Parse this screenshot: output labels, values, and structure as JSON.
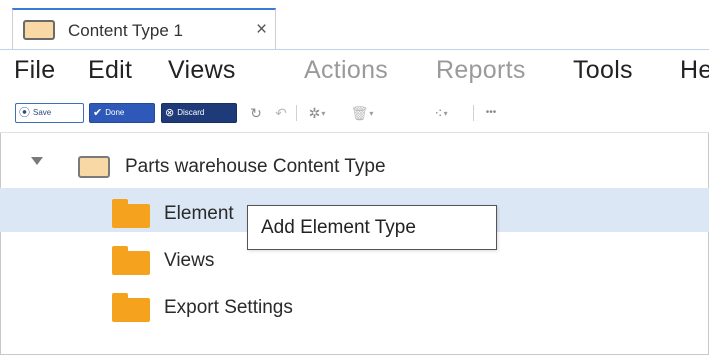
{
  "tab": {
    "title": "Content Type 1",
    "close": "×"
  },
  "menu": [
    {
      "label": "File",
      "enabled": true
    },
    {
      "label": "Edit",
      "enabled": true
    },
    {
      "label": "Views",
      "enabled": true
    },
    {
      "label": "Actions",
      "enabled": false
    },
    {
      "label": "Reports",
      "enabled": false
    },
    {
      "label": "Tools",
      "enabled": true
    },
    {
      "label": "He",
      "enabled": true
    }
  ],
  "toolbar": {
    "save_label": "Save",
    "done_label": "Done",
    "discard_label": "Discard",
    "more_label": "•••"
  },
  "tree": {
    "root_label": "Parts warehouse Content Type",
    "items": [
      {
        "label": "Element",
        "selected": true
      },
      {
        "label": "Views",
        "selected": false
      },
      {
        "label": "Export Settings",
        "selected": false
      }
    ]
  },
  "tooltip": {
    "text": "Add Element Type"
  },
  "colors": {
    "accent": "#3a7bd5",
    "selection": "#dce7f6",
    "folder_orange": "#f5a21e",
    "folder_tan": "#f8d8a4",
    "done_button": "#2f59b8",
    "discard_button": "#1f3a78"
  }
}
